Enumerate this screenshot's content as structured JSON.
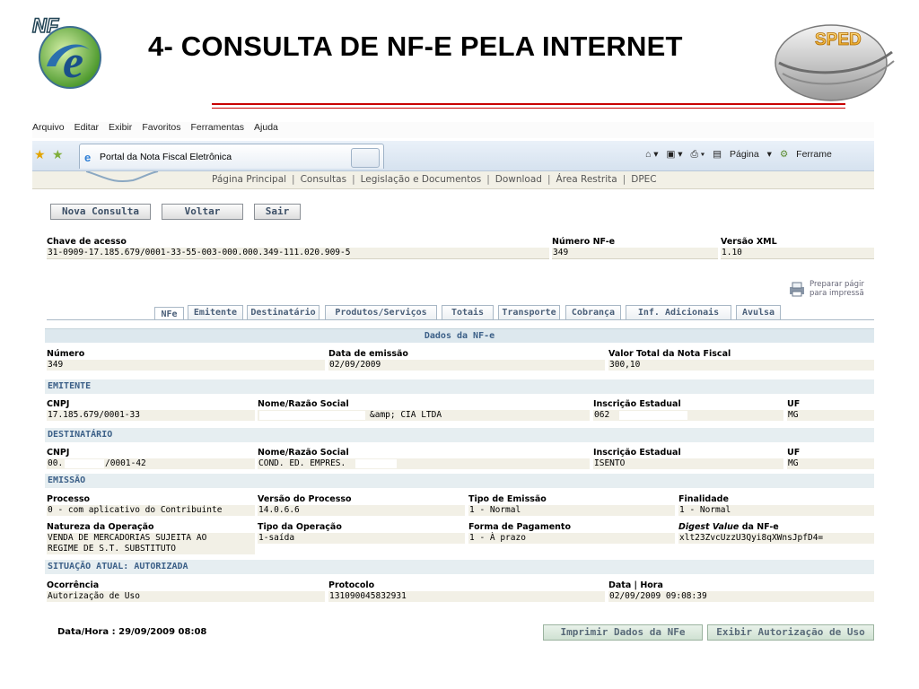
{
  "slide": {
    "title": "4- CONSULTA DE NF-E PELA INTERNET",
    "logo_left_text": "NF",
    "logo_left_letter": "e",
    "logo_right_text": "SPED"
  },
  "browser": {
    "menu": [
      "Arquivo",
      "Editar",
      "Exibir",
      "Favoritos",
      "Ferramentas",
      "Ajuda"
    ],
    "tab_title": "Portal da Nota Fiscal Eletrônica",
    "tools": {
      "page": "Página",
      "tools": "Ferrame"
    }
  },
  "nav": {
    "links": [
      "Página Principal",
      "Consultas",
      "Legislação e Documentos",
      "Download",
      "Área Restrita",
      "DPEC"
    ]
  },
  "actions": {
    "new_query": "Nova Consulta",
    "back": "Voltar",
    "exit": "Sair"
  },
  "key": {
    "chave_label": "Chave de acesso",
    "chave_value": "31-0909-17.185.679/0001-33-55-003-000.000.349-111.020.909-5",
    "numero_label": "Número NF-e",
    "numero_value": "349",
    "versao_label": "Versão XML",
    "versao_value": "1.10"
  },
  "print_link": {
    "line1": "Preparar págir",
    "line2": "para impressã"
  },
  "tabs": [
    "NFe",
    "Emitente",
    "Destinatário",
    "Produtos/Serviços",
    "Totais",
    "Transporte",
    "Cobrança",
    "Inf. Adicionais",
    "Avulsa"
  ],
  "dados": {
    "header": "Dados da NF-e",
    "numero_label": "Número",
    "numero_value": "349",
    "data_label": "Data de emissão",
    "data_value": "02/09/2009",
    "valor_label": "Valor Total da Nota Fiscal",
    "valor_value": "300,10"
  },
  "emitente": {
    "header": "EMITENTE",
    "cnpj_label": "CNPJ",
    "cnpj_value": "17.185.679/0001-33",
    "nome_label": "Nome/Razão Social",
    "nome_value": "&amp; CIA LTDA",
    "ie_label": "Inscrição Estadual",
    "ie_value": "062",
    "uf_label": "UF",
    "uf_value": "MG"
  },
  "destinatario": {
    "header": "DESTINATÁRIO",
    "cnpj_label": "CNPJ",
    "cnpj_prefix": "00.",
    "cnpj_suffix": "/0001-42",
    "nome_label": "Nome/Razão Social",
    "nome_value": "COND. ED. EMPRES.",
    "ie_label": "Inscrição Estadual",
    "ie_value": "ISENTO",
    "uf_label": "UF",
    "uf_value": "MG"
  },
  "emissao": {
    "header": "EMISSÃO",
    "processo_label": "Processo",
    "processo_value": "0 - com aplicativo do Contribuinte",
    "versao_label": "Versão do Processo",
    "versao_value": "14.0.6.6",
    "tipo_label": "Tipo de Emissão",
    "tipo_value": "1 - Normal",
    "finalidade_label": "Finalidade",
    "finalidade_value": "1 - Normal",
    "natureza_label": "Natureza da Operação",
    "natureza_line1": "VENDA DE MERCADORIAS SUJEITA AO",
    "natureza_line2": "REGIME DE S.T. SUBSTITUTO",
    "tipo_op_label": "Tipo da Operação",
    "tipo_op_value": "1-saída",
    "forma_label": "Forma de Pagamento",
    "forma_value": "1 - À prazo",
    "digest_label_italic": "Digest Value",
    "digest_label_rest": " da NF-e",
    "digest_value": "xlt23ZvcUzzU3Qyi8qXWnsJpfD4="
  },
  "situacao": {
    "header": "SITUAÇÃO ATUAL: AUTORIZADA",
    "ocorrencia_label": "Ocorrência",
    "ocorrencia_value": "Autorização de Uso",
    "protocolo_label": "Protocolo",
    "protocolo_value": "131090045832931",
    "datahora_label": "Data | Hora",
    "datahora_value": "02/09/2009 09:08:39"
  },
  "footer": {
    "datahora": "Data/Hora : 29/09/2009 08:08",
    "print_btn": "Imprimir Dados da NFe",
    "auth_btn": "Exibir Autorização de Uso"
  },
  "colors": {
    "rule": "#c80000",
    "section": "#3c6088",
    "field_bg": "#f2f0e6"
  }
}
